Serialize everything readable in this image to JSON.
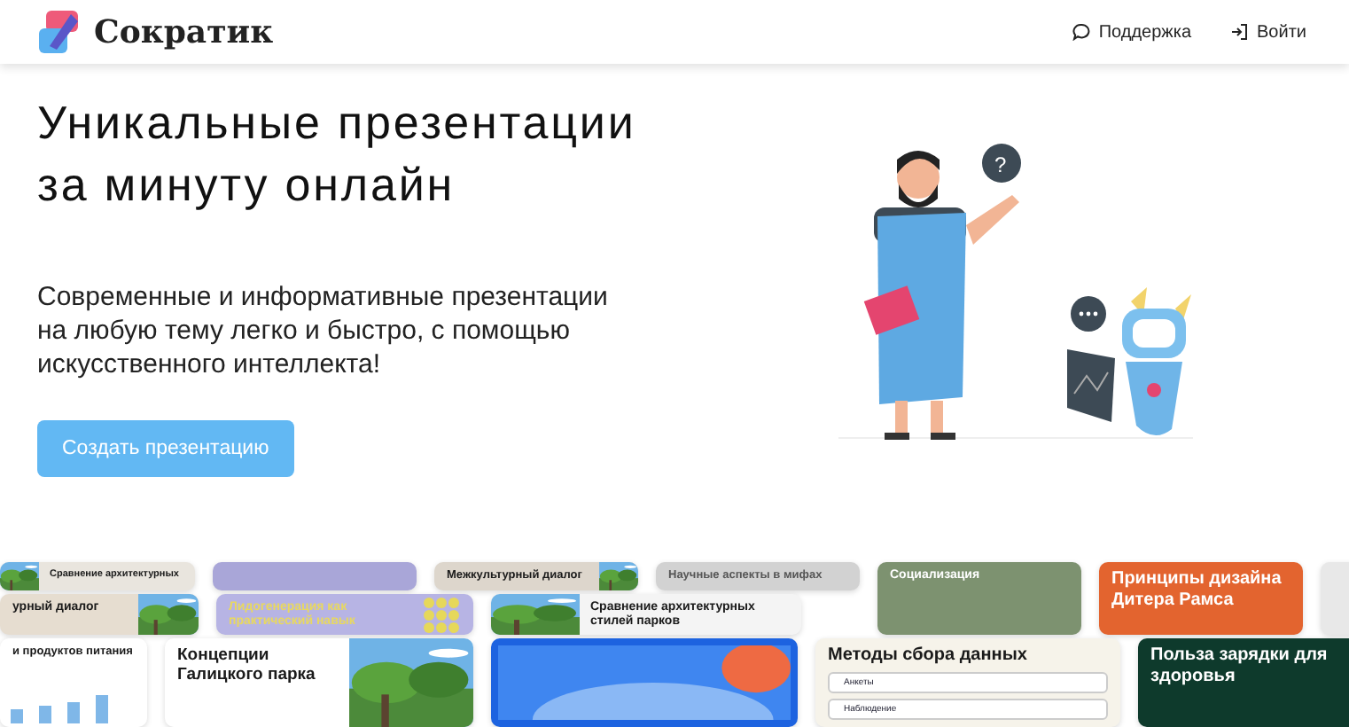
{
  "header": {
    "logo": "Сократик",
    "nav": [
      {
        "label": "Поддержка",
        "kind": "chat"
      },
      {
        "label": "Войти",
        "kind": "login"
      }
    ]
  },
  "hero": {
    "title_lines": [
      "Уникальные презентации",
      "за минуту онлайн"
    ],
    "subtitle": "Современные и информативные презентации на любую тему легко и быстро, с помощью искусственного интеллекта!",
    "button": "Создать презентацию"
  },
  "illustration": {
    "bubble": "?"
  },
  "slides": [
    {
      "title": "Сравнение архитектурных",
      "kind": "photo-left",
      "color": "#e9e5de"
    },
    {
      "kind": "plain",
      "color": "#a9a6d8"
    },
    {
      "title": "Межкультурный диалог",
      "kind": "photo-right",
      "color": "#ddd6cc"
    },
    {
      "title": "Научные аспекты в мифах",
      "kind": "plain",
      "color": "#d2d2d2"
    },
    {
      "title": "урный диалог",
      "kind": "photo-right",
      "color": "#e6ddd0"
    },
    {
      "title": "Лидогенерация как практический навык",
      "kind": "dots",
      "color": "#b7b4e4"
    },
    {
      "title": "Сравнение архитектурных стилей парков",
      "kind": "photo-left",
      "color": "#f4f4f4"
    },
    {
      "title": "Социализация",
      "kind": "plain",
      "color": "#7d9270"
    },
    {
      "title": "Принципы дизайна Дитера Рамса",
      "kind": "plain",
      "color": "#e3642f"
    },
    {
      "kind": "plain",
      "color": "#e8e8e8"
    },
    {
      "title": "и продуктов питания",
      "kind": "bars",
      "color": "#ffffff"
    },
    {
      "title": "Концепции Галицкого парка",
      "kind": "photo-right",
      "color": "#ffffff"
    },
    {
      "kind": "gradient",
      "color": "#1d63e0"
    },
    {
      "title": "Методы сбора данных",
      "kind": "list",
      "color": "#f6f3ea",
      "items": [
        "Анкеты",
        "Наблюдение"
      ]
    },
    {
      "title": "Польза зарядки для здоровья",
      "kind": "plain",
      "color": "#0e3a2c"
    }
  ]
}
